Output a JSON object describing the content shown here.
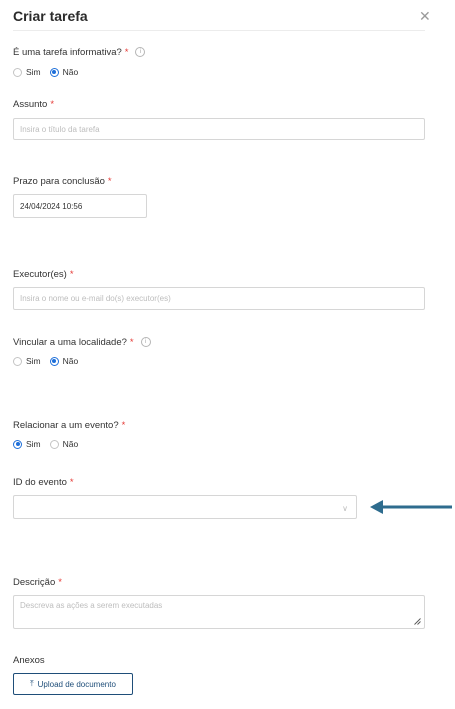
{
  "modal": {
    "title": "Criar tarefa",
    "close_icon": "close-icon"
  },
  "informativa": {
    "label": "É uma tarefa informativa?",
    "required": "*",
    "options": [
      "Sim",
      "Não"
    ],
    "selected": "Não"
  },
  "assunto": {
    "label": "Assunto",
    "required": "*",
    "placeholder": "Insira o título da tarefa"
  },
  "prazo": {
    "label": "Prazo para conclusão",
    "required": "*",
    "value": "24/04/2024 10:56"
  },
  "executor": {
    "label": "Executor(es)",
    "required": "*",
    "placeholder": "Insira o nome ou e-mail do(s) executor(es)"
  },
  "localidade": {
    "label": "Vincular a uma localidade?",
    "required": "*",
    "options": [
      "Sim",
      "Não"
    ],
    "selected": "Não"
  },
  "evento": {
    "label": "Relacionar a um evento?",
    "required": "*",
    "options": [
      "Sim",
      "Não"
    ],
    "selected": "Sim"
  },
  "id_evento": {
    "label": "ID do evento",
    "required": "*",
    "value": ""
  },
  "descricao": {
    "label": "Descrição",
    "required": "*",
    "placeholder": "Descreva as ações a serem executadas"
  },
  "anexos": {
    "label": "Anexos",
    "upload_label": "Upload de documento"
  },
  "colors": {
    "accent": "#1e6fd9",
    "required": "#e53935",
    "button_border": "#1f4e79",
    "annotation_arrow": "#2e6c8e"
  }
}
